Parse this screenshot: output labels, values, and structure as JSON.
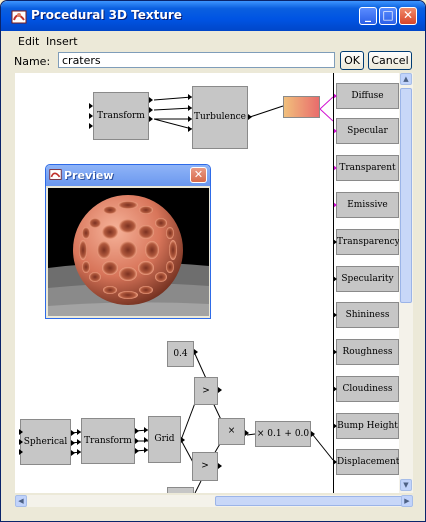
{
  "window": {
    "title": "Procedural 3D Texture",
    "min_glyph": "_",
    "max_glyph": "□",
    "close_glyph": "✕"
  },
  "menu": {
    "items": [
      "Edit",
      "Insert"
    ]
  },
  "namebar": {
    "label": "Name:",
    "value": "craters",
    "ok_label": "OK",
    "cancel_label": "Cancel"
  },
  "nodes": {
    "transform1": "Transform",
    "turbulence": "Turbulence",
    "const_04": "0.4",
    "greater1": ">",
    "greater2": ">",
    "multiply": "×",
    "linear": "× 0.1 + 0.0",
    "spherical": "Spherical",
    "transform2": "Transform",
    "grid": "Grid"
  },
  "outputs": [
    "Diffuse",
    "Specular",
    "Transparent",
    "Emissive",
    "Transparency",
    "Specularity",
    "Shininess",
    "Roughness",
    "Cloudiness",
    "Bump Height",
    "Displacement"
  ],
  "preview": {
    "title": "Preview",
    "close_glyph": "✕"
  },
  "colors": {
    "titlebar": "#0054e3",
    "window_bg": "#ece9d8",
    "node": "#c6c6c6",
    "highlight_port": "#d10ed1",
    "sphere": "#d8755a"
  }
}
